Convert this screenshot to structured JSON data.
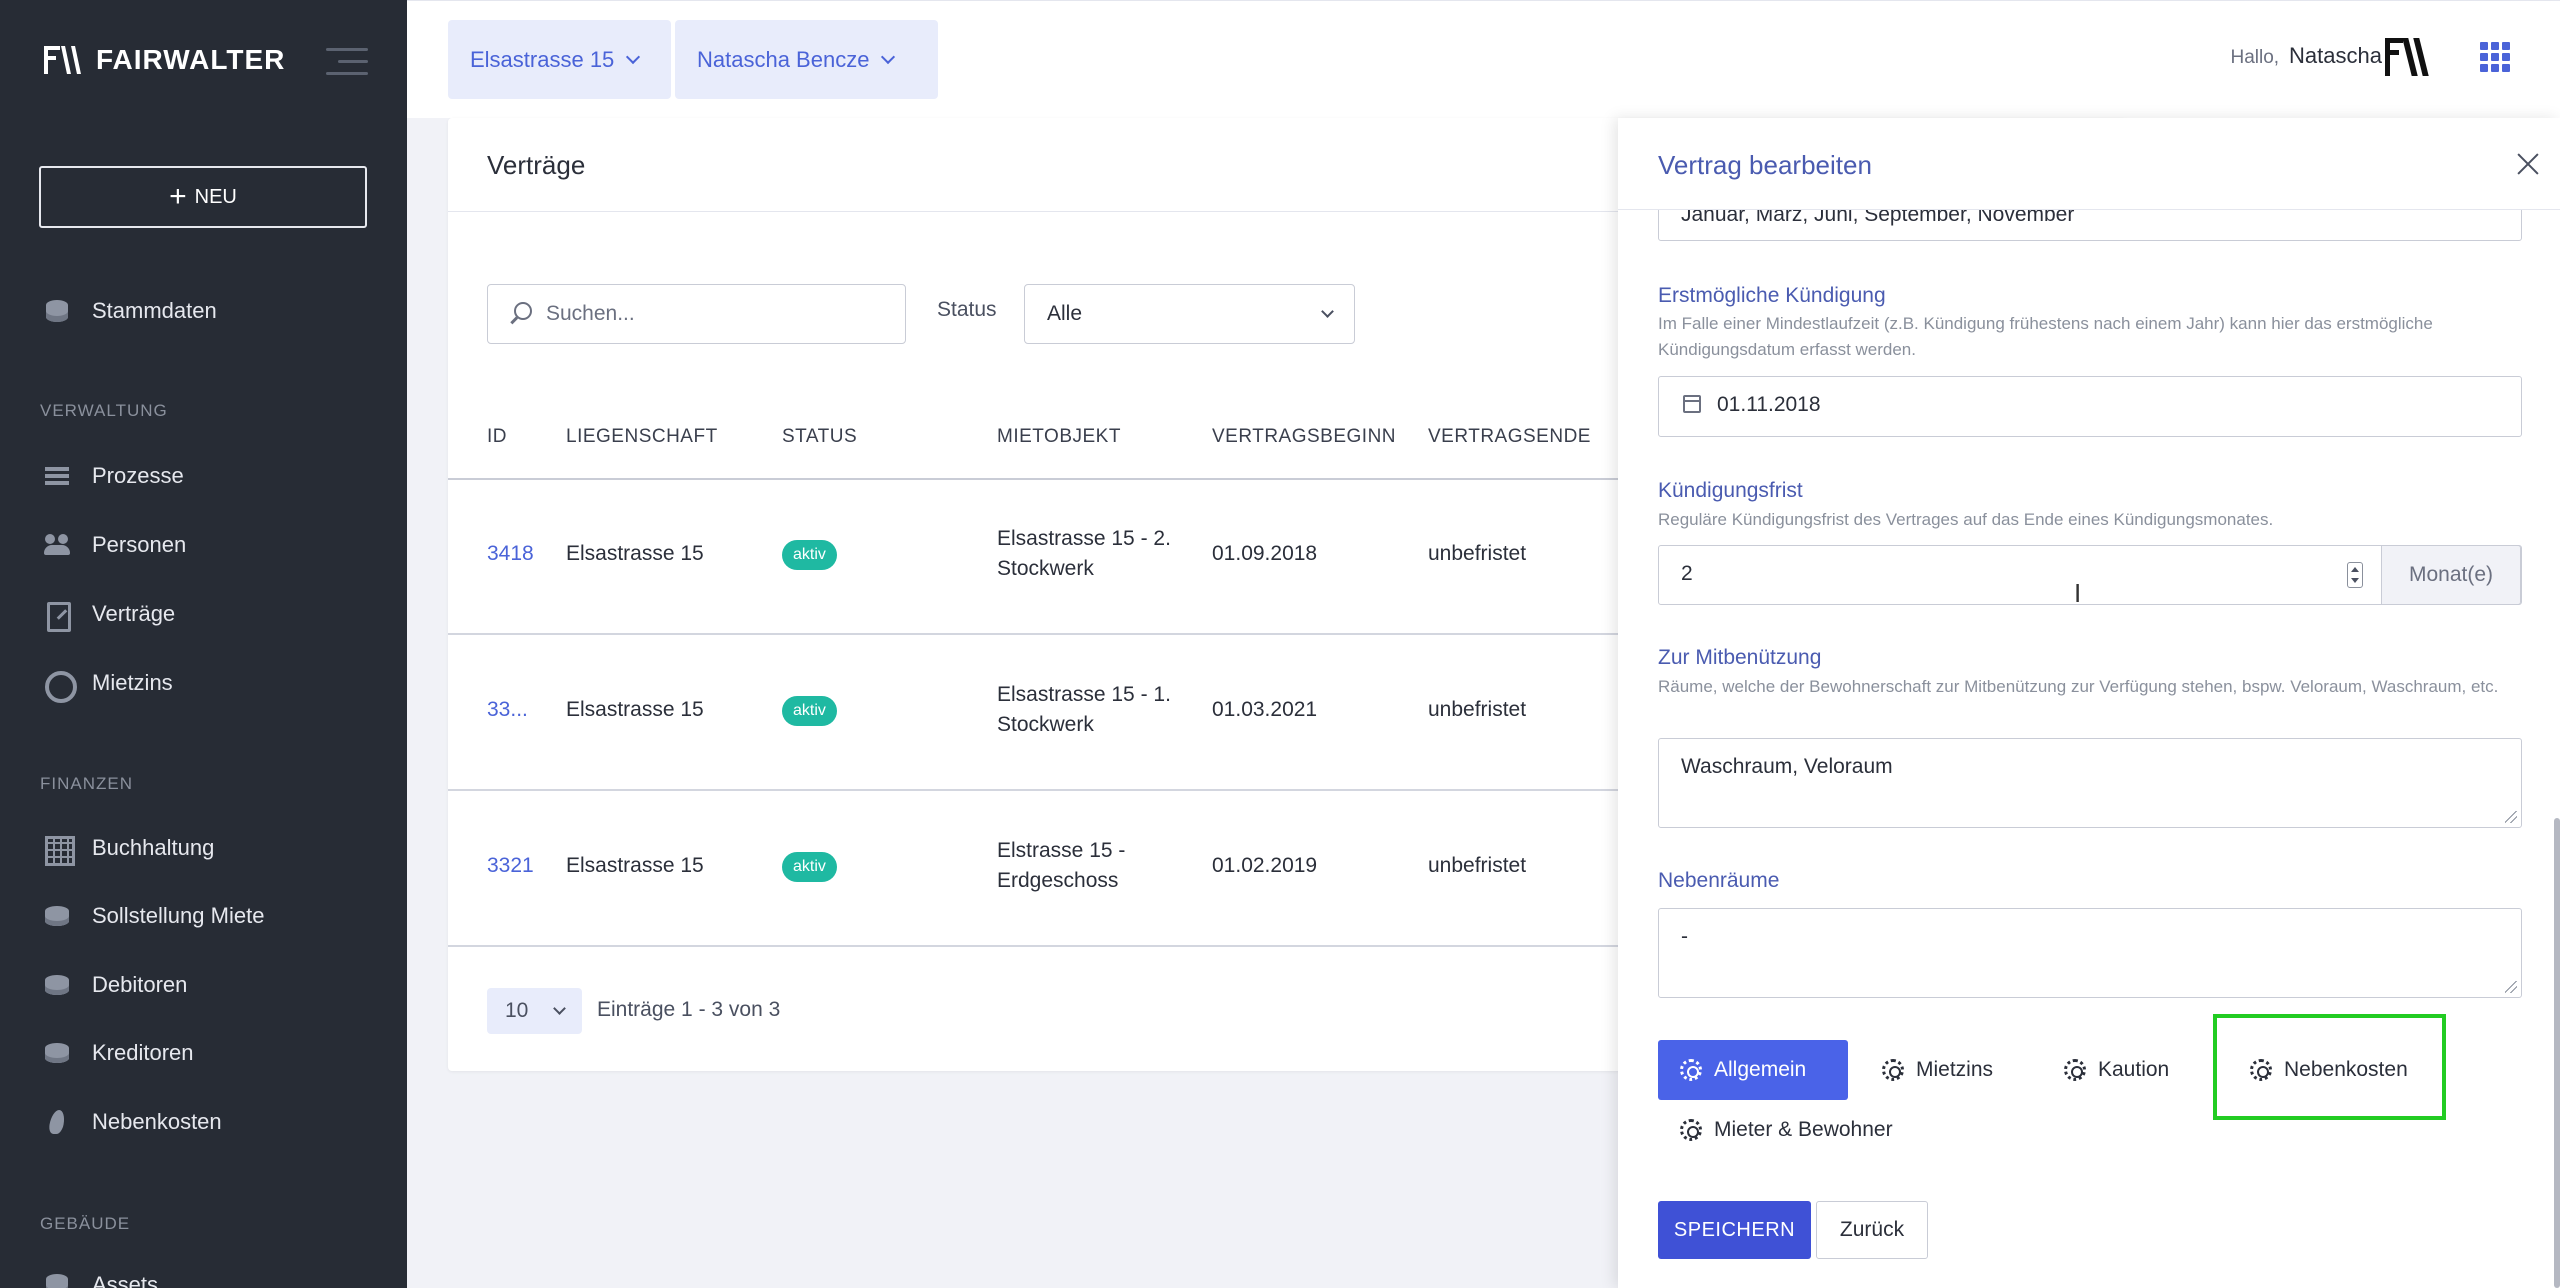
{
  "app": {
    "logo_text": "FAIRWALTER",
    "new_button": "NEU"
  },
  "sidebar": {
    "stammdaten": "Stammdaten",
    "sections": {
      "verwaltung": "VERWALTUNG",
      "finanzen": "FINANZEN",
      "gebaeude": "GEBÄUDE"
    },
    "verwaltung_items": [
      {
        "label": "Prozesse",
        "icon": "list-icon"
      },
      {
        "label": "Personen",
        "icon": "people-icon"
      },
      {
        "label": "Verträge",
        "icon": "document-edit-icon"
      },
      {
        "label": "Mietzins",
        "icon": "coin-icon"
      }
    ],
    "finanzen_items": [
      {
        "label": "Buchhaltung",
        "icon": "grid-icon"
      },
      {
        "label": "Sollstellung Miete",
        "icon": "coins-icon"
      },
      {
        "label": "Debitoren",
        "icon": "coins-icon"
      },
      {
        "label": "Kreditoren",
        "icon": "coins-icon"
      },
      {
        "label": "Nebenkosten",
        "icon": "fire-icon"
      }
    ],
    "gebaeude_items": [
      {
        "label": "Assets",
        "icon": "building-icon"
      }
    ]
  },
  "topbar": {
    "property": "Elsastrasse 15",
    "person": "Natascha Bencze",
    "hallo": "Hallo,",
    "user": "Natascha"
  },
  "contracts": {
    "title": "Verträge",
    "search_placeholder": "Suchen...",
    "status_label": "Status",
    "status_value": "Alle",
    "columns": [
      "ID",
      "LIEGENSCHAFT",
      "STATUS",
      "MIETOBJEKT",
      "VERTRAGSBEGINN",
      "VERTRAGSENDE"
    ],
    "rows": [
      {
        "id": "3418",
        "liegenschaft": "Elsastrasse 15",
        "status": "aktiv",
        "mietobjekt_1": "Elsastrasse 15 - 2.",
        "mietobjekt_2": "Stockwerk",
        "beginn": "01.09.2018",
        "ende": "unbefristet"
      },
      {
        "id": "33...",
        "liegenschaft": "Elsastrasse 15",
        "status": "aktiv",
        "mietobjekt_1": "Elsastrasse 15 - 1.",
        "mietobjekt_2": "Stockwerk",
        "beginn": "01.03.2021",
        "ende": "unbefristet"
      },
      {
        "id": "3321",
        "liegenschaft": "Elsastrasse 15",
        "status": "aktiv",
        "mietobjekt_1": "Elstrasse 15 -",
        "mietobjekt_2": "Erdgeschoss",
        "beginn": "01.02.2019",
        "ende": "unbefristet"
      }
    ],
    "page_size": "10",
    "entries": "Einträge 1 - 3 von 3"
  },
  "panel": {
    "title": "Vertrag bearbeiten",
    "months_value": "Januar, März, Juni, September, November",
    "kuendigung_label": "Erstmögliche Kündigung",
    "kuendigung_help": "Im Falle einer Mindestlaufzeit (z.B. Kündigung frühestens nach einem Jahr) kann hier das erstmögliche Kündigungsdatum erfasst werden.",
    "kuendigung_value": "01.11.2018",
    "frist_label": "Kündigungsfrist",
    "frist_help": "Reguläre Kündigungsfrist des Vertrages auf das Ende eines Kündigungsmonates.",
    "frist_value": "2",
    "frist_unit": "Monat(e)",
    "mitbenuetzung_label": "Zur Mitbenützung",
    "mitbenuetzung_help": "Räume, welche der Bewohnerschaft zur Mitbenützung zur Verfügung stehen, bspw. Veloraum, Waschraum, etc.",
    "mitbenuetzung_value": "Waschraum, Veloraum",
    "nebenraeume_label": "Nebenräume",
    "nebenraeume_value": "-",
    "tabs": [
      "Allgemein",
      "Mietzins",
      "Kaution",
      "Nebenkosten",
      "Mieter & Bewohner"
    ],
    "save": "SPEICHERN",
    "back": "Zurück"
  },
  "colors": {
    "sidebar_bg": "#272c35",
    "accent": "#4a63e8",
    "badge": "#1fb9a2",
    "highlight": "#22cc22"
  }
}
